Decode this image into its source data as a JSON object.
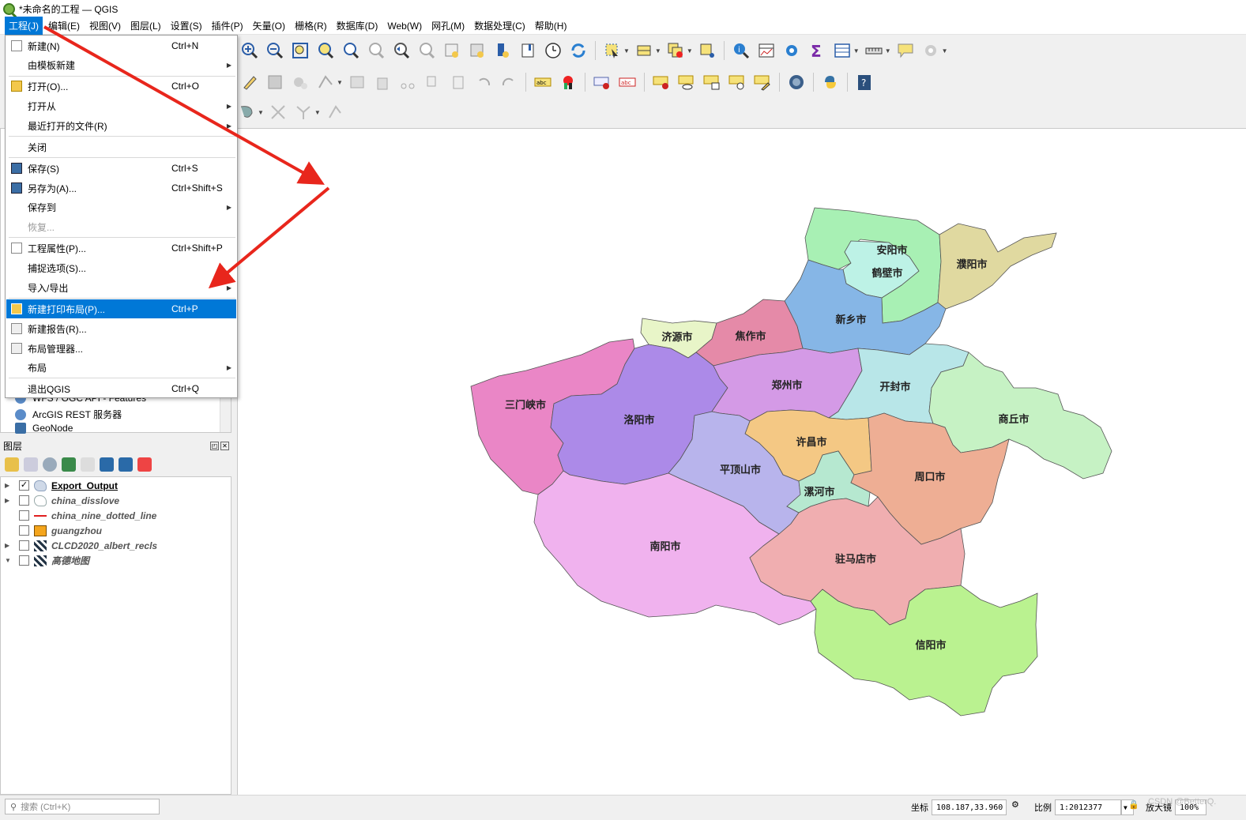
{
  "window": {
    "title": "*未命名的工程 — QGIS"
  },
  "menubar": [
    "工程(J)",
    "编辑(E)",
    "视图(V)",
    "图层(L)",
    "设置(S)",
    "插件(P)",
    "矢量(O)",
    "栅格(R)",
    "数据库(D)",
    "Web(W)",
    "网孔(M)",
    "数据处理(C)",
    "帮助(H)"
  ],
  "project_menu": {
    "items": [
      {
        "label": "新建(N)",
        "shortcut": "Ctrl+N",
        "icon": "new-file-icon"
      },
      {
        "label": "由模板新建",
        "submenu": true
      },
      {
        "label": "打开(O)...",
        "shortcut": "Ctrl+O",
        "icon": "folder-icon"
      },
      {
        "label": "打开从",
        "submenu": true
      },
      {
        "label": "最近打开的文件(R)",
        "submenu": true
      },
      {
        "label": "关闭"
      },
      {
        "label": "保存(S)",
        "shortcut": "Ctrl+S",
        "icon": "save-icon"
      },
      {
        "label": "另存为(A)...",
        "shortcut": "Ctrl+Shift+S",
        "icon": "save-as-icon"
      },
      {
        "label": "保存到",
        "submenu": true
      },
      {
        "label": "恢复...",
        "disabled": true
      },
      {
        "label": "工程属性(P)...",
        "shortcut": "Ctrl+Shift+P",
        "icon": "project-properties-icon"
      },
      {
        "label": "捕捉选项(S)..."
      },
      {
        "label": "导入/导出",
        "submenu": true
      },
      {
        "label": "新建打印布局(P)...",
        "shortcut": "Ctrl+P",
        "icon": "new-layout-icon",
        "highlighted": true
      },
      {
        "label": "新建报告(R)...",
        "icon": "new-report-icon"
      },
      {
        "label": "布局管理器...",
        "icon": "layout-manager-icon"
      },
      {
        "label": "布局",
        "submenu": true
      },
      {
        "label": "退出QGIS",
        "shortcut": "Ctrl+Q"
      }
    ]
  },
  "browser": {
    "items": [
      "WFS / OGC API - Features",
      "ArcGIS REST 服务器",
      "GeoNode"
    ]
  },
  "layers_panel": {
    "title": "图层",
    "layers": [
      {
        "name": "Export_Output",
        "checked": true,
        "type": "polygon",
        "expanded": false
      },
      {
        "name": "china_disslove",
        "checked": false,
        "type": "polygon",
        "expanded": false
      },
      {
        "name": "china_nine_dotted_line",
        "checked": false,
        "type": "line"
      },
      {
        "name": "guangzhou",
        "checked": false,
        "type": "fill"
      },
      {
        "name": "CLCD2020_albert_recls",
        "checked": false,
        "type": "raster",
        "expanded": false
      },
      {
        "name": "高德地图",
        "checked": false,
        "type": "raster",
        "expanded": true
      }
    ]
  },
  "map": {
    "labels": [
      "安阳市",
      "鹤壁市",
      "濮阳市",
      "新乡市",
      "济源市",
      "焦作市",
      "三门峡市",
      "洛阳市",
      "郑州市",
      "开封市",
      "商丘市",
      "许昌市",
      "平顶山市",
      "漯河市",
      "周口市",
      "南阳市",
      "驻马店市",
      "信阳市"
    ],
    "colors": {
      "anyang": "#a8f0b4",
      "hebi": "#bdf2e6",
      "puyang": "#e0d9a0",
      "xinxiang": "#86b6e6",
      "jiyuan": "#e8f5c8",
      "jiaozuo": "#e58aa8",
      "sanmenxia": "#ea86c6",
      "luoyang": "#ac8ae8",
      "zhengzhou": "#d49ae6",
      "kaifeng": "#b8e6e8",
      "shangqiu": "#c6f2c4",
      "xuchang": "#f4c884",
      "pingdingshan": "#b8b4ec",
      "luohe": "#b6e8d0",
      "zhoukou": "#eeae94",
      "nanyang": "#f0b2ee",
      "zhumadian": "#f0aeb0",
      "xinyang": "#baf290"
    }
  },
  "statusbar": {
    "search_placeholder": "搜索 (Ctrl+K)",
    "coord_label": "坐标",
    "coord_value": "108.187,33.960",
    "scale_label": "比例",
    "scale_value": "1:2012377",
    "magnifier_label": "放大镜",
    "magnifier_value": "100%",
    "watermark": "CSDN @BetterQ."
  }
}
